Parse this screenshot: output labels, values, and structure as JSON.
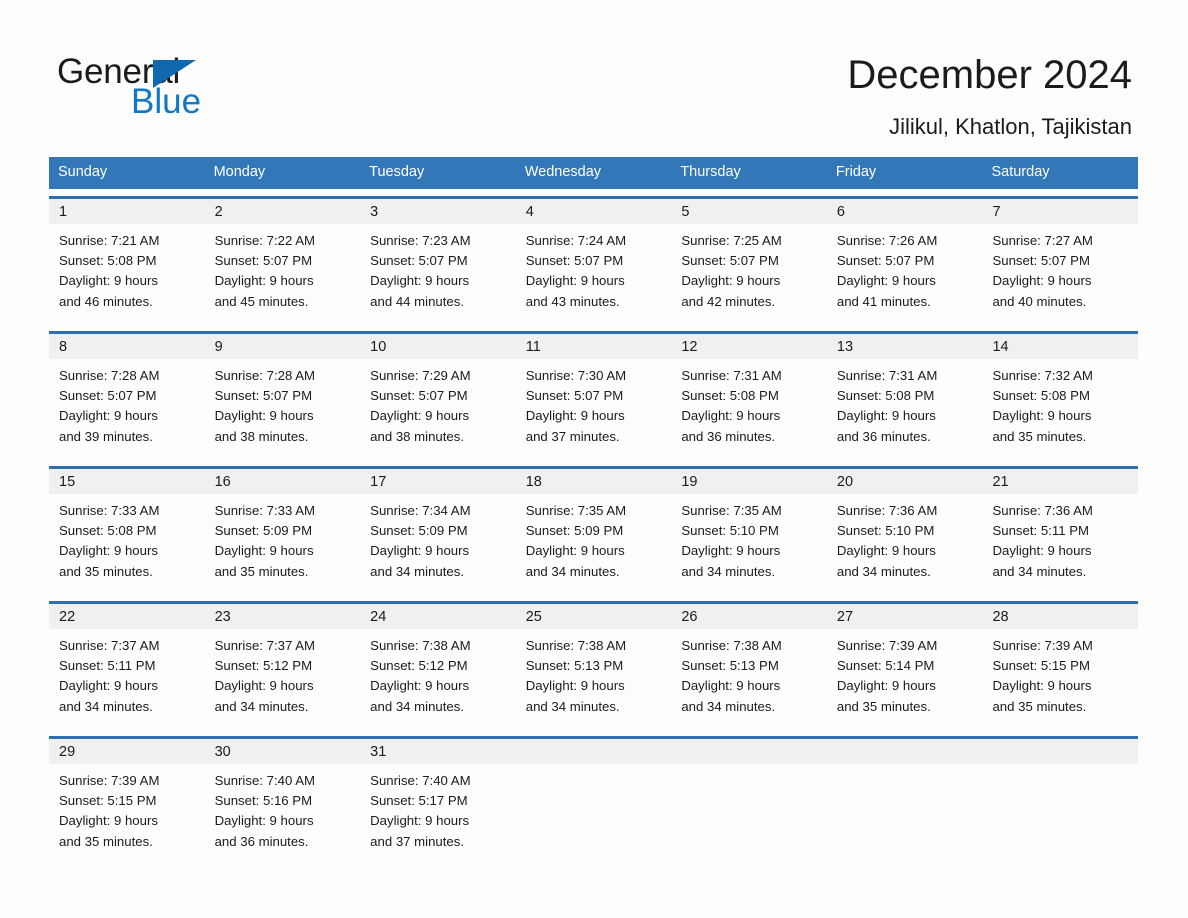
{
  "brand": {
    "name_part1": "General",
    "name_part2": "Blue",
    "accent_color": "#1069ae"
  },
  "header": {
    "title": "December 2024",
    "subtitle": "Jilikul, Khatlon, Tajikistan"
  },
  "theme": {
    "header_row_bg": "#3277b8",
    "week_divider": "#2f6fae",
    "daynum_band_bg": "#f0f0f0",
    "page_bg": "#fdfdfd",
    "text": "#1b1b1b"
  },
  "day_names": [
    "Sunday",
    "Monday",
    "Tuesday",
    "Wednesday",
    "Thursday",
    "Friday",
    "Saturday"
  ],
  "labels": {
    "sunrise": "Sunrise:",
    "sunset": "Sunset:",
    "daylight": "Daylight:"
  },
  "weeks": [
    {
      "days": [
        {
          "num": "1",
          "l1": "Sunrise: 7:21 AM",
          "l2": "Sunset: 5:08 PM",
          "l3": "Daylight: 9 hours",
          "l4": "and 46 minutes."
        },
        {
          "num": "2",
          "l1": "Sunrise: 7:22 AM",
          "l2": "Sunset: 5:07 PM",
          "l3": "Daylight: 9 hours",
          "l4": "and 45 minutes."
        },
        {
          "num": "3",
          "l1": "Sunrise: 7:23 AM",
          "l2": "Sunset: 5:07 PM",
          "l3": "Daylight: 9 hours",
          "l4": "and 44 minutes."
        },
        {
          "num": "4",
          "l1": "Sunrise: 7:24 AM",
          "l2": "Sunset: 5:07 PM",
          "l3": "Daylight: 9 hours",
          "l4": "and 43 minutes."
        },
        {
          "num": "5",
          "l1": "Sunrise: 7:25 AM",
          "l2": "Sunset: 5:07 PM",
          "l3": "Daylight: 9 hours",
          "l4": "and 42 minutes."
        },
        {
          "num": "6",
          "l1": "Sunrise: 7:26 AM",
          "l2": "Sunset: 5:07 PM",
          "l3": "Daylight: 9 hours",
          "l4": "and 41 minutes."
        },
        {
          "num": "7",
          "l1": "Sunrise: 7:27 AM",
          "l2": "Sunset: 5:07 PM",
          "l3": "Daylight: 9 hours",
          "l4": "and 40 minutes."
        }
      ]
    },
    {
      "days": [
        {
          "num": "8",
          "l1": "Sunrise: 7:28 AM",
          "l2": "Sunset: 5:07 PM",
          "l3": "Daylight: 9 hours",
          "l4": "and 39 minutes."
        },
        {
          "num": "9",
          "l1": "Sunrise: 7:28 AM",
          "l2": "Sunset: 5:07 PM",
          "l3": "Daylight: 9 hours",
          "l4": "and 38 minutes."
        },
        {
          "num": "10",
          "l1": "Sunrise: 7:29 AM",
          "l2": "Sunset: 5:07 PM",
          "l3": "Daylight: 9 hours",
          "l4": "and 38 minutes."
        },
        {
          "num": "11",
          "l1": "Sunrise: 7:30 AM",
          "l2": "Sunset: 5:07 PM",
          "l3": "Daylight: 9 hours",
          "l4": "and 37 minutes."
        },
        {
          "num": "12",
          "l1": "Sunrise: 7:31 AM",
          "l2": "Sunset: 5:08 PM",
          "l3": "Daylight: 9 hours",
          "l4": "and 36 minutes."
        },
        {
          "num": "13",
          "l1": "Sunrise: 7:31 AM",
          "l2": "Sunset: 5:08 PM",
          "l3": "Daylight: 9 hours",
          "l4": "and 36 minutes."
        },
        {
          "num": "14",
          "l1": "Sunrise: 7:32 AM",
          "l2": "Sunset: 5:08 PM",
          "l3": "Daylight: 9 hours",
          "l4": "and 35 minutes."
        }
      ]
    },
    {
      "days": [
        {
          "num": "15",
          "l1": "Sunrise: 7:33 AM",
          "l2": "Sunset: 5:08 PM",
          "l3": "Daylight: 9 hours",
          "l4": "and 35 minutes."
        },
        {
          "num": "16",
          "l1": "Sunrise: 7:33 AM",
          "l2": "Sunset: 5:09 PM",
          "l3": "Daylight: 9 hours",
          "l4": "and 35 minutes."
        },
        {
          "num": "17",
          "l1": "Sunrise: 7:34 AM",
          "l2": "Sunset: 5:09 PM",
          "l3": "Daylight: 9 hours",
          "l4": "and 34 minutes."
        },
        {
          "num": "18",
          "l1": "Sunrise: 7:35 AM",
          "l2": "Sunset: 5:09 PM",
          "l3": "Daylight: 9 hours",
          "l4": "and 34 minutes."
        },
        {
          "num": "19",
          "l1": "Sunrise: 7:35 AM",
          "l2": "Sunset: 5:10 PM",
          "l3": "Daylight: 9 hours",
          "l4": "and 34 minutes."
        },
        {
          "num": "20",
          "l1": "Sunrise: 7:36 AM",
          "l2": "Sunset: 5:10 PM",
          "l3": "Daylight: 9 hours",
          "l4": "and 34 minutes."
        },
        {
          "num": "21",
          "l1": "Sunrise: 7:36 AM",
          "l2": "Sunset: 5:11 PM",
          "l3": "Daylight: 9 hours",
          "l4": "and 34 minutes."
        }
      ]
    },
    {
      "days": [
        {
          "num": "22",
          "l1": "Sunrise: 7:37 AM",
          "l2": "Sunset: 5:11 PM",
          "l3": "Daylight: 9 hours",
          "l4": "and 34 minutes."
        },
        {
          "num": "23",
          "l1": "Sunrise: 7:37 AM",
          "l2": "Sunset: 5:12 PM",
          "l3": "Daylight: 9 hours",
          "l4": "and 34 minutes."
        },
        {
          "num": "24",
          "l1": "Sunrise: 7:38 AM",
          "l2": "Sunset: 5:12 PM",
          "l3": "Daylight: 9 hours",
          "l4": "and 34 minutes."
        },
        {
          "num": "25",
          "l1": "Sunrise: 7:38 AM",
          "l2": "Sunset: 5:13 PM",
          "l3": "Daylight: 9 hours",
          "l4": "and 34 minutes."
        },
        {
          "num": "26",
          "l1": "Sunrise: 7:38 AM",
          "l2": "Sunset: 5:13 PM",
          "l3": "Daylight: 9 hours",
          "l4": "and 34 minutes."
        },
        {
          "num": "27",
          "l1": "Sunrise: 7:39 AM",
          "l2": "Sunset: 5:14 PM",
          "l3": "Daylight: 9 hours",
          "l4": "and 35 minutes."
        },
        {
          "num": "28",
          "l1": "Sunrise: 7:39 AM",
          "l2": "Sunset: 5:15 PM",
          "l3": "Daylight: 9 hours",
          "l4": "and 35 minutes."
        }
      ]
    },
    {
      "days": [
        {
          "num": "29",
          "l1": "Sunrise: 7:39 AM",
          "l2": "Sunset: 5:15 PM",
          "l3": "Daylight: 9 hours",
          "l4": "and 35 minutes."
        },
        {
          "num": "30",
          "l1": "Sunrise: 7:40 AM",
          "l2": "Sunset: 5:16 PM",
          "l3": "Daylight: 9 hours",
          "l4": "and 36 minutes."
        },
        {
          "num": "31",
          "l1": "Sunrise: 7:40 AM",
          "l2": "Sunset: 5:17 PM",
          "l3": "Daylight: 9 hours",
          "l4": "and 37 minutes."
        },
        {
          "num": "",
          "l1": "",
          "l2": "",
          "l3": "",
          "l4": ""
        },
        {
          "num": "",
          "l1": "",
          "l2": "",
          "l3": "",
          "l4": ""
        },
        {
          "num": "",
          "l1": "",
          "l2": "",
          "l3": "",
          "l4": ""
        },
        {
          "num": "",
          "l1": "",
          "l2": "",
          "l3": "",
          "l4": ""
        }
      ]
    }
  ]
}
